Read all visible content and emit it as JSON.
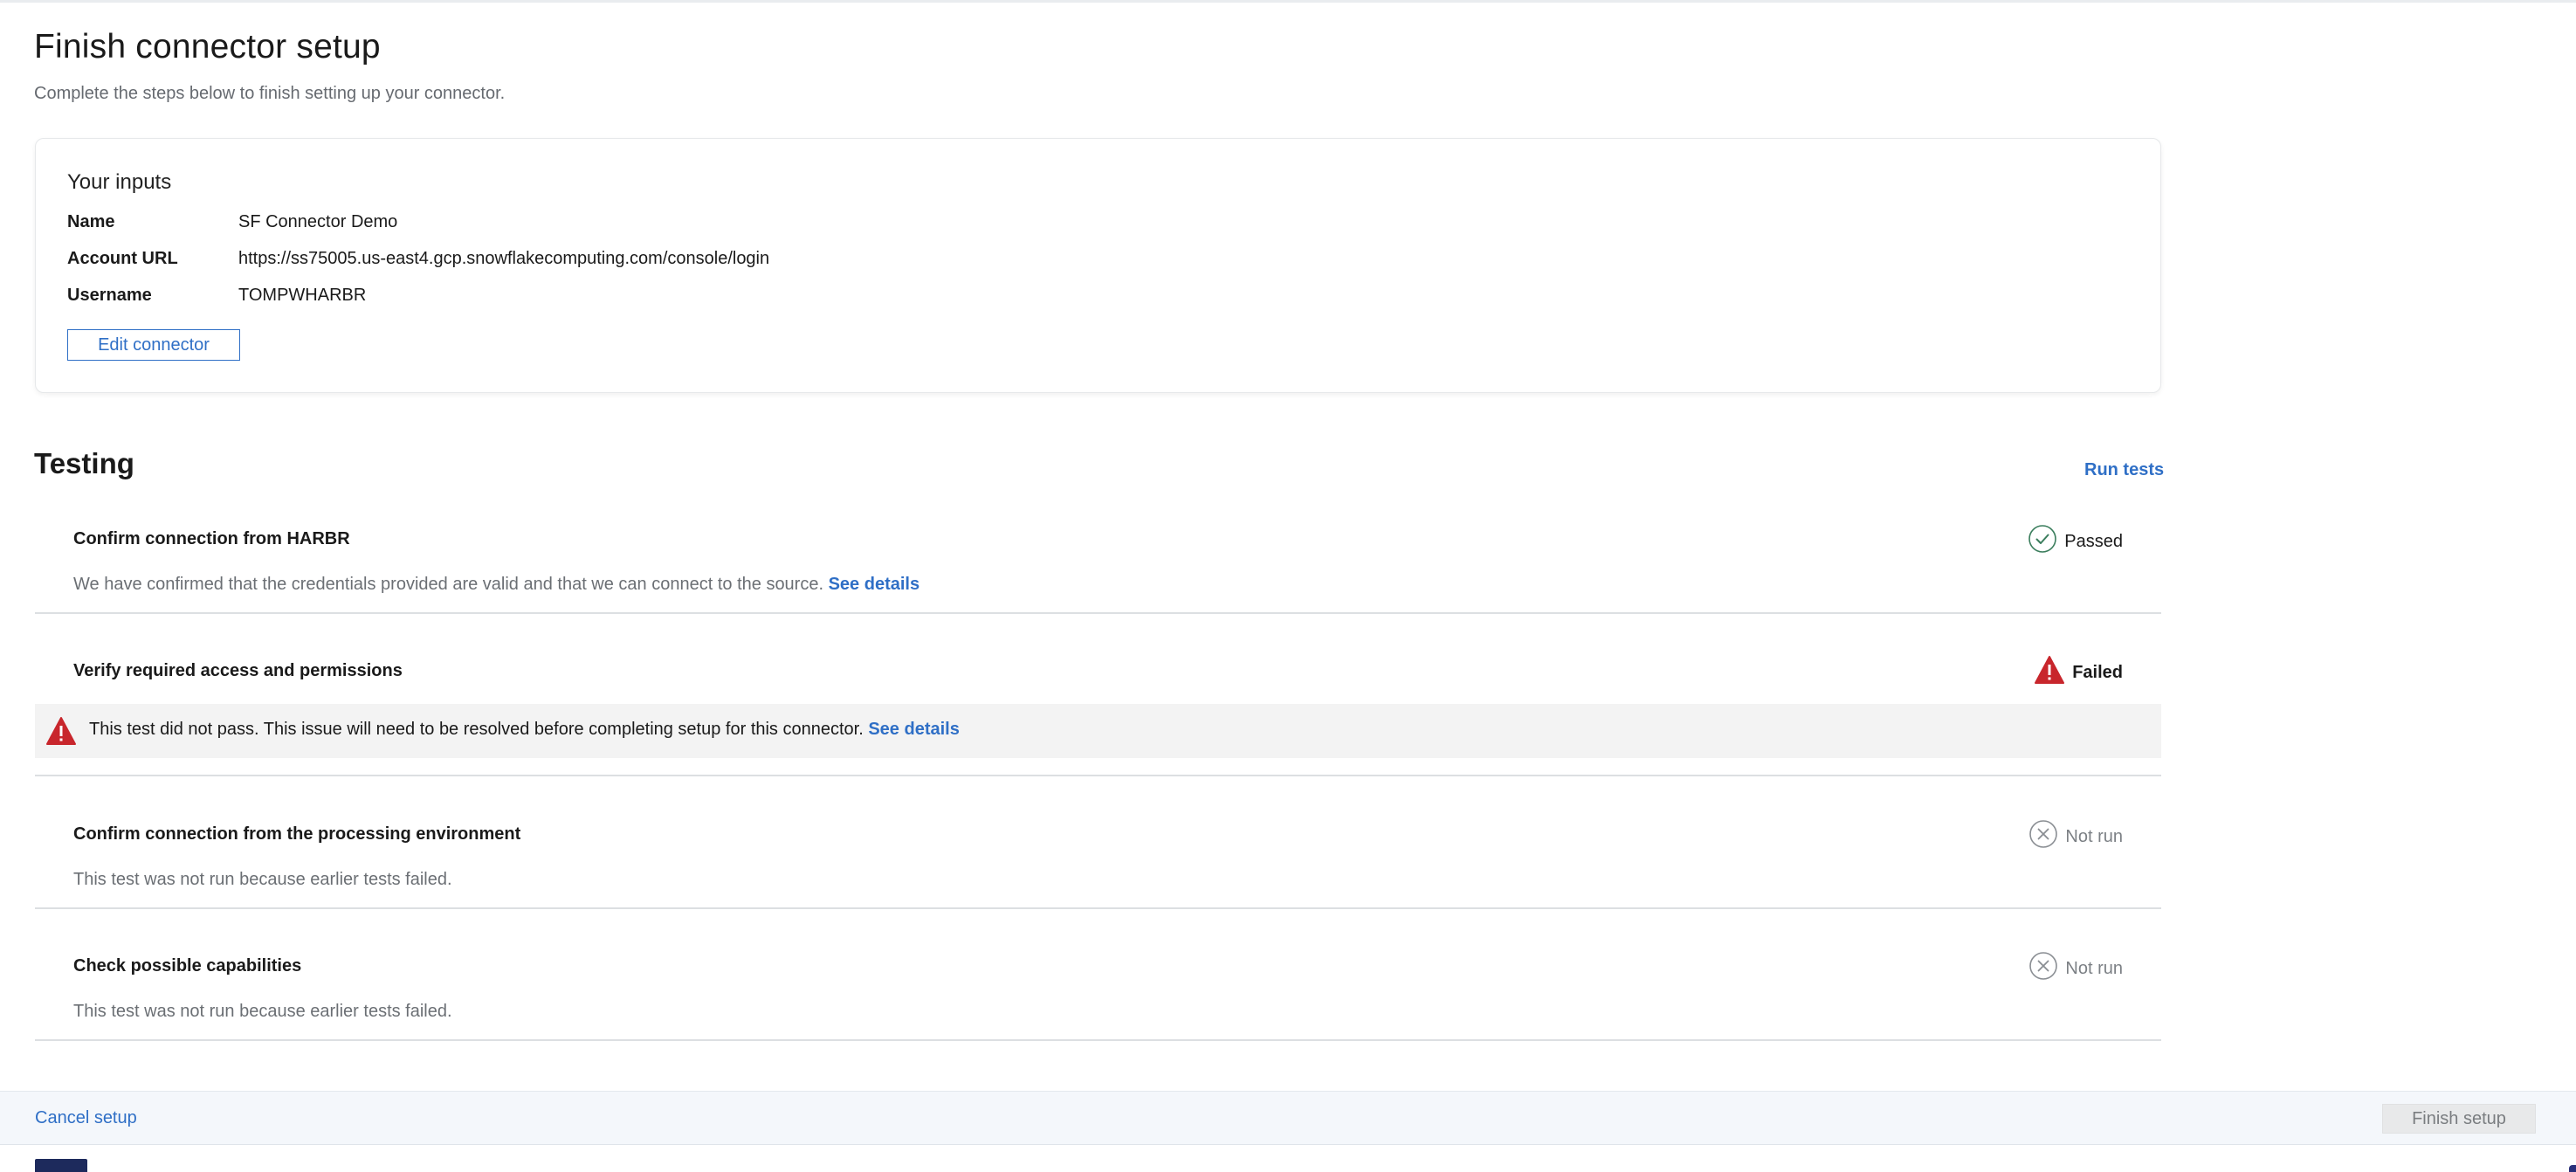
{
  "page": {
    "title": "Finish connector setup",
    "subtitle": "Complete the steps below to finish setting up your connector."
  },
  "inputs": {
    "title": "Your inputs",
    "fields": [
      {
        "label": "Name",
        "value": "SF Connector Demo"
      },
      {
        "label": "Account URL",
        "value": "https://ss75005.us-east4.gcp.snowflakecomputing.com/console/login"
      },
      {
        "label": "Username",
        "value": "TOMPWHARBR"
      }
    ],
    "edit_label": "Edit connector"
  },
  "testing": {
    "title": "Testing",
    "run_label": "Run tests",
    "see_details": "See details",
    "tests": [
      {
        "name": "Confirm connection from HARBR",
        "status": "Passed",
        "description": "We have confirmed that the credentials provided are valid and that we can connect to the source."
      },
      {
        "name": "Verify required access and permissions",
        "status": "Failed",
        "description": "This test did not pass. This issue will need to be resolved before completing setup for this connector."
      },
      {
        "name": "Confirm connection from the processing environment",
        "status": "Not run",
        "description": "This test was not run because earlier tests failed."
      },
      {
        "name": "Check possible capabilities",
        "status": "Not run",
        "description": "This test was not run because earlier tests failed."
      }
    ]
  },
  "footer": {
    "cancel_label": "Cancel setup",
    "finish_label": "Finish setup"
  },
  "icons": {
    "passed": "check-circle-icon",
    "failed": "warning-triangle-icon",
    "not_run": "x-circle-icon"
  },
  "colors": {
    "link": "#2f6fc6",
    "danger": "#c8262c",
    "passed": "#3a7d5c",
    "muted": "#8a8e93"
  }
}
